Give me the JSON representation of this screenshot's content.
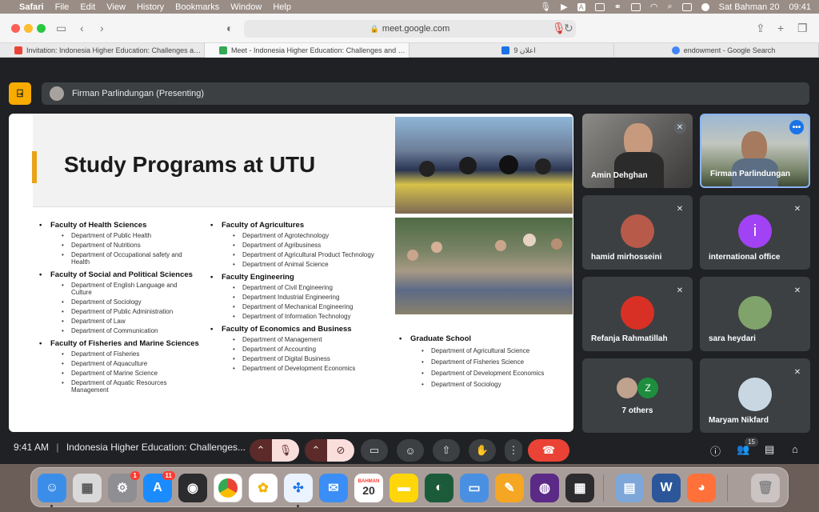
{
  "menubar": {
    "app": "Safari",
    "items": [
      "File",
      "Edit",
      "View",
      "History",
      "Bookmarks",
      "Window",
      "Help"
    ],
    "date": "Sat Bahman 20",
    "time": "09:41"
  },
  "browser": {
    "url": "meet.google.com",
    "tabs": [
      {
        "label": "Invitation: Indonesia Higher Education: Challenges and...",
        "favicon_color": "#ea4335"
      },
      {
        "label": "Meet - Indonesia Higher Education: Challenges and Op...",
        "favicon_color": "#34a853",
        "active": true
      },
      {
        "label": "9 اعلان",
        "favicon_color": "#1a73e8"
      },
      {
        "label": "endowment - Google Search",
        "favicon_color": "#4285f4"
      }
    ]
  },
  "meet": {
    "logo_glyph": "⍈",
    "presenter_label": "Firman Parlindungan (Presenting)",
    "slide": {
      "title": "Study Programs at UTU",
      "columns": [
        [
          {
            "faculty": "Faculty of Health Sciences",
            "depts": [
              "Department of Public Health",
              "Department of Nutritions",
              "Department of Occupational safety and Health"
            ]
          },
          {
            "faculty": "Faculty of Social and Political Sciences",
            "depts": [
              "Department of English Language and Culture",
              "Department of Sociology",
              "Department of Public Administration",
              "Department of Law",
              "Department of Communication"
            ]
          },
          {
            "faculty": "Faculty of Fisheries and Marine Sciences",
            "depts": [
              "Department of Fisheries",
              "Department of Aquaculture",
              "Department of Marine Science",
              "Department of Aquatic Resources Management"
            ]
          }
        ],
        [
          {
            "faculty": "Faculty of Agricultures",
            "depts": [
              "Department of Agrotechnology",
              "Department of Agribusiness",
              "Department of Agricultural Product Technology",
              "Department of Animal Science"
            ]
          },
          {
            "faculty": "Faculty Engineering",
            "depts": [
              "Department of Civil Engineering",
              "Department Industrial Engineering",
              "Department of Mechanical Engineering",
              "Department of Information Technology"
            ]
          },
          {
            "faculty": "Faculty of Economics and Business",
            "depts": [
              "Department of Management",
              "Department of Accounting",
              "Department of Digital Business",
              "Department of Development Economics"
            ]
          }
        ],
        [
          {
            "faculty": "Graduate School",
            "depts": [
              "Department of Agricultural Science",
              "Department of Fisheries Science",
              "Department of Development Economics",
              "Department of Sociology"
            ]
          }
        ]
      ]
    },
    "participants": [
      {
        "name": "Amin Dehghan",
        "muted": true
      },
      {
        "name": "Firman Parlindungan",
        "muted": false,
        "more": "•••"
      },
      {
        "name": "hamid mirhosseini",
        "muted": true
      },
      {
        "name": "international office",
        "muted": true,
        "initial": "i"
      },
      {
        "name": "Refanja Rahmatillah",
        "muted": true
      },
      {
        "name": "sara heydari",
        "muted": true
      },
      {
        "name": "7 others",
        "muted": false,
        "initial": "Z"
      },
      {
        "name": "Maryam Nikfard",
        "muted": true
      }
    ],
    "bottom": {
      "time": "9:41 AM",
      "separator": "|",
      "meeting_title": "Indonesia Higher Education: Challenges...",
      "people_count": "15"
    }
  },
  "dock": {
    "calendar_month": "BAHMAN",
    "calendar_day": "20",
    "settings_badge": "1",
    "appstore_badge": "11"
  },
  "colors": {
    "meet_bg": "#202124",
    "tile_bg": "#3c4043",
    "accent": "#f9ab00",
    "end_call": "#ea4335",
    "active_speaker_border": "#8ab4f8"
  }
}
